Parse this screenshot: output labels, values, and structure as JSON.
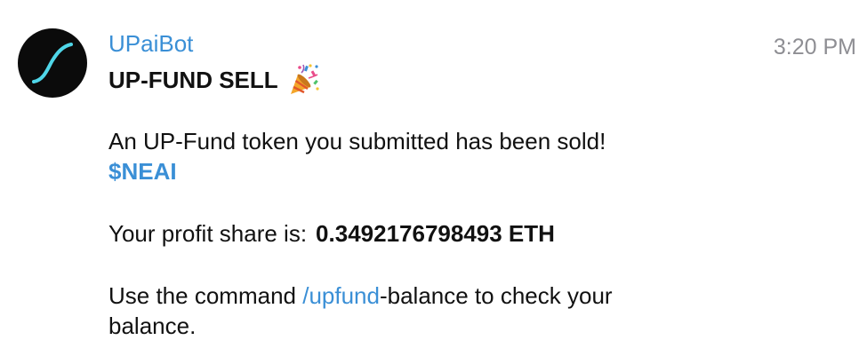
{
  "message": {
    "sender": "UPaiBot",
    "time": "3:20 PM",
    "title": "UP-FUND SELL",
    "title_icon": "party-popper-icon",
    "line1": "An UP-Fund token you submitted has been sold!",
    "ticker": "$NEAI",
    "profit_label": "Your profit share is:",
    "profit_value": "0.3492176798493 ETH",
    "command_prefix": "Use the command ",
    "command_link": "/upfund",
    "command_suffix": "-balance to check your",
    "command_line2": "balance."
  },
  "colors": {
    "link": "#3a8fd6",
    "timestamp": "#8e8e93",
    "avatar_bg": "#0b0b0b",
    "avatar_curve": "#4fd6e8"
  }
}
